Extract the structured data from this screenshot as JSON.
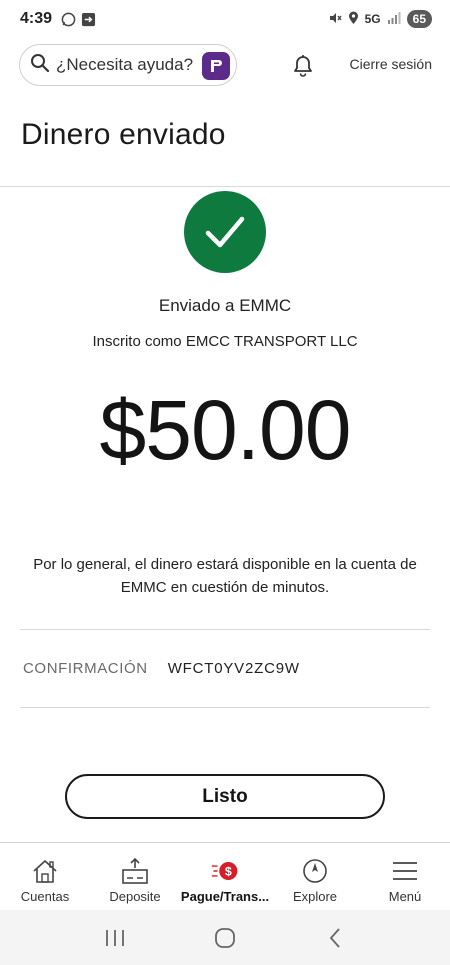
{
  "status_bar": {
    "time": "4:39",
    "network": "5G",
    "battery": "65"
  },
  "header": {
    "search_label": "¿Necesita ayuda?",
    "logout_label": "Cierre sesión"
  },
  "page": {
    "title": "Dinero enviado",
    "sent_to": "Enviado a EMMC",
    "enrolled_as": "Inscrito como EMCC TRANSPORT LLC",
    "amount": "$50.00",
    "availability_note": "Por lo general, el dinero estará disponible en la cuenta de EMMC en cuestión de minutos.",
    "confirmation_label": "CONFIRMACIÓN",
    "confirmation_value": "WFCT0YV2ZC9W",
    "done_label": "Listo"
  },
  "bottom_nav": {
    "items": [
      {
        "label": "Cuentas",
        "icon": "house-icon"
      },
      {
        "label": "Deposite",
        "icon": "deposit-icon"
      },
      {
        "label": "Pague/Trans...",
        "icon": "dollar-transfer-icon",
        "active": true
      },
      {
        "label": "Explore",
        "icon": "compass-icon"
      },
      {
        "label": "Menú",
        "icon": "menu-icon"
      }
    ]
  },
  "colors": {
    "success_green": "#0f7a3e",
    "accent_red": "#d71e28",
    "assistant_purple": "#5c2a8a"
  }
}
